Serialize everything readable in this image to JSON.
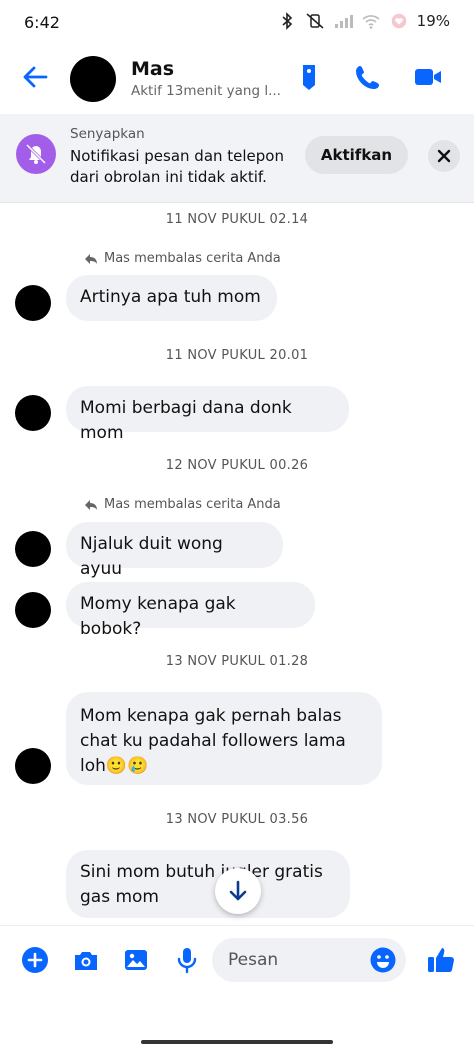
{
  "status_bar": {
    "time": "6:42",
    "battery": "19%"
  },
  "header": {
    "name": "Mas",
    "status": "Aktif 13menit yang l..."
  },
  "mute_banner": {
    "title": "Senyapkan",
    "description": "Notifikasi pesan dan telepon dari obrolan ini tidak aktif.",
    "action_label": "Aktifkan"
  },
  "conversation": [
    {
      "timestamp": "11 NOV PUKUL 02.14",
      "reply_note": "Mas membalas cerita Anda",
      "message": "Artinya apa tuh mom"
    },
    {
      "timestamp": "11 NOV PUKUL 20.01",
      "message": "Momi berbagi dana donk mom"
    },
    {
      "timestamp": "12 NOV PUKUL 00.26",
      "reply_note": "Mas membalas cerita Anda",
      "message": "Njaluk duit wong ayuu"
    },
    {
      "message": "Momy kenapa gak bobok?"
    },
    {
      "timestamp": "13 NOV PUKUL 01.28",
      "message": "Mom kenapa gak pernah balas chat ku padahal followers lama loh🙂🥲"
    },
    {
      "timestamp": "13 NOV PUKUL 03.56",
      "message": "Sini mom butuh jugler gratis gas mom"
    }
  ],
  "composer": {
    "placeholder": "Pesan"
  },
  "colors": {
    "accent": "#0866ff",
    "mute_purple": "#a35ee9",
    "bubble_bg": "#f0f1f5"
  }
}
